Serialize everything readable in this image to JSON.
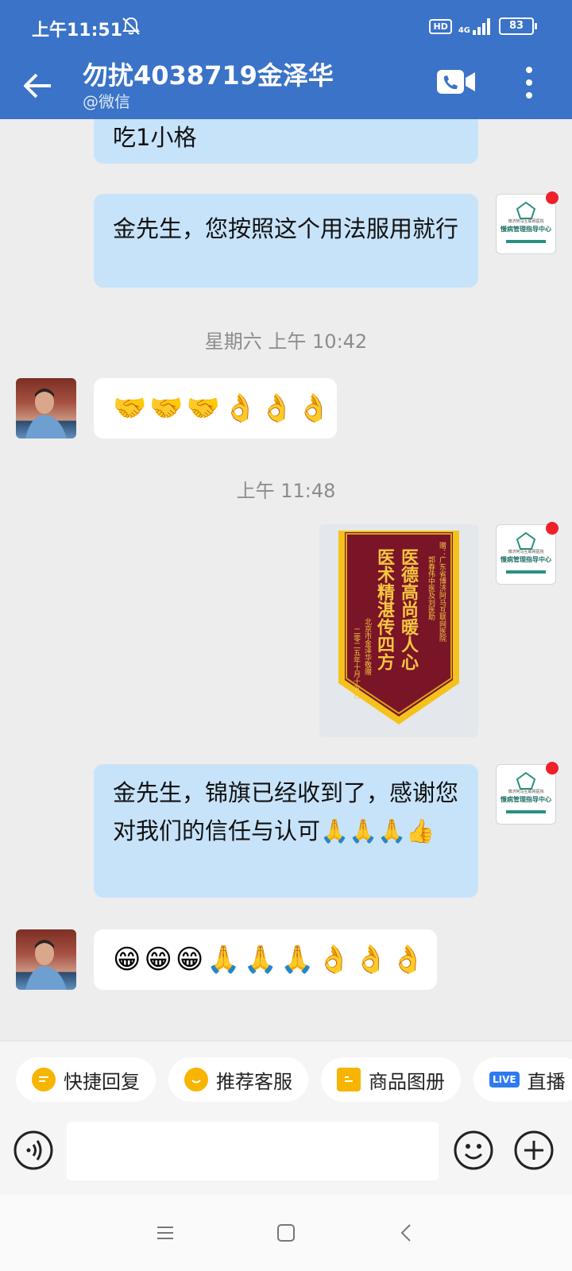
{
  "status_bar": {
    "time": "上午11:51",
    "hd": "HD",
    "network": "4G",
    "battery": "83"
  },
  "header": {
    "title": "勿扰4038719金泽华",
    "subtitle": "@微信"
  },
  "messages": [
    {
      "side": "out",
      "text": "吃1小格"
    },
    {
      "side": "out",
      "text": "金先生，您按照这个用法服用就行"
    },
    {
      "type": "timestamp",
      "text": "星期六  上午 10:42"
    },
    {
      "side": "in",
      "emojis": [
        "🤝",
        "🤝",
        "🤝",
        "👌",
        "👌",
        "👌"
      ]
    },
    {
      "type": "timestamp",
      "text": "上午 11:48"
    },
    {
      "side": "out",
      "type": "image",
      "banner": {
        "line_right": "赠：广东省博济阿马互联网医院",
        "line_right2": "郭春伟中医及刘医助",
        "main1": "医德高尚暖人心",
        "main2": "医术精湛传四方",
        "sign": "北京市金泽华敬赠",
        "date": "二零二五年十月十五日"
      }
    },
    {
      "side": "out",
      "text": "金先生，锦旗已经收到了，感谢您对我们的信任与认可🙏🙏🙏👍"
    },
    {
      "side": "in",
      "emojis": [
        "😁",
        "😁",
        "😁",
        "🙏",
        "🙏",
        "🙏",
        "👌",
        "👌",
        "👌"
      ]
    }
  ],
  "self_avatar": {
    "line1": "博济阿马互联网医院",
    "line2": "慢病管理指导中心"
  },
  "quick_replies": [
    {
      "label": "快捷回复",
      "icon": "chat-bubble-icon"
    },
    {
      "label": "推荐客服",
      "icon": "service-icon"
    },
    {
      "label": "商品图册",
      "icon": "catalog-icon"
    },
    {
      "label": "直播",
      "icon": "live-icon",
      "badge": "LIVE"
    }
  ],
  "colors": {
    "header": "#3a73c7",
    "bubble_out": "#c7e3fa",
    "bubble_in": "#ffffff",
    "background": "#ededed"
  }
}
